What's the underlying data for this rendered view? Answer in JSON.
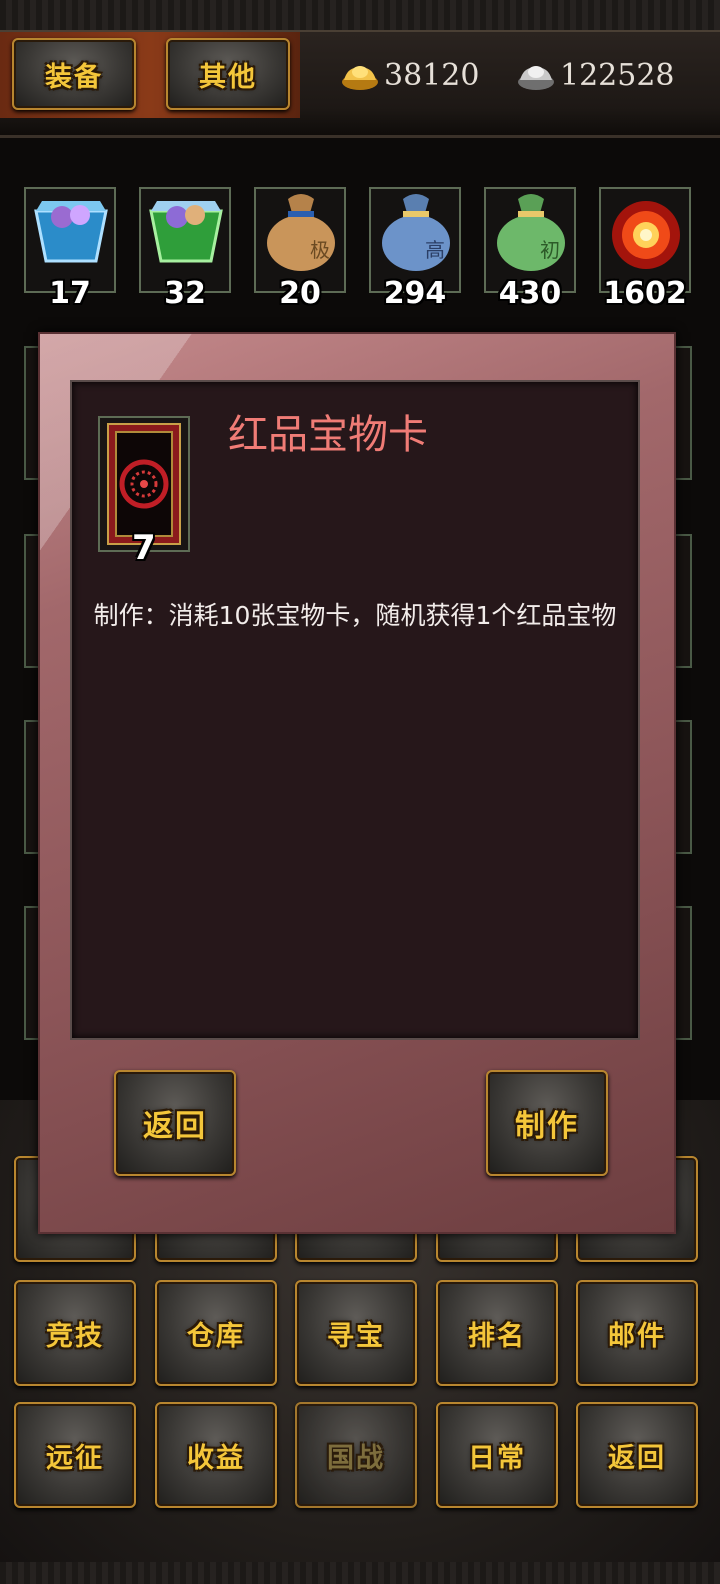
{
  "header": {
    "tabs": [
      {
        "label": "装备"
      },
      {
        "label": "其他"
      }
    ],
    "gold": {
      "icon": "gold-ingot-icon",
      "value": "38120"
    },
    "silver": {
      "icon": "silver-ingot-icon",
      "value": "122528"
    }
  },
  "inventory": {
    "items": [
      {
        "icon": "blue-gem-box-icon",
        "count": "17"
      },
      {
        "icon": "green-gem-box-icon",
        "count": "32"
      },
      {
        "icon": "tan-bag-icon",
        "glyph": "极",
        "count": "20"
      },
      {
        "icon": "blue-bag-icon",
        "glyph": "高",
        "count": "294"
      },
      {
        "icon": "green-bag-icon",
        "glyph": "初",
        "count": "430"
      },
      {
        "icon": "fire-orb-icon",
        "count": "1602"
      }
    ]
  },
  "dialog": {
    "card_icon": "red-treasure-card-icon",
    "card_count": "7",
    "title": "红品宝物卡",
    "description": "制作：消耗10张宝物卡，随机获得1个红品宝物",
    "back_label": "返回",
    "make_label": "制作"
  },
  "menu": {
    "row2": [
      "竞技",
      "仓库",
      "寻宝",
      "排名",
      "邮件"
    ],
    "row3": [
      "远征",
      "收益",
      "国战",
      "日常",
      "返回"
    ],
    "disabled": [
      "国战"
    ]
  },
  "colors": {
    "button_text": "#f4c63a",
    "title_red": "#f07c76",
    "button_border": "#b8862f"
  }
}
